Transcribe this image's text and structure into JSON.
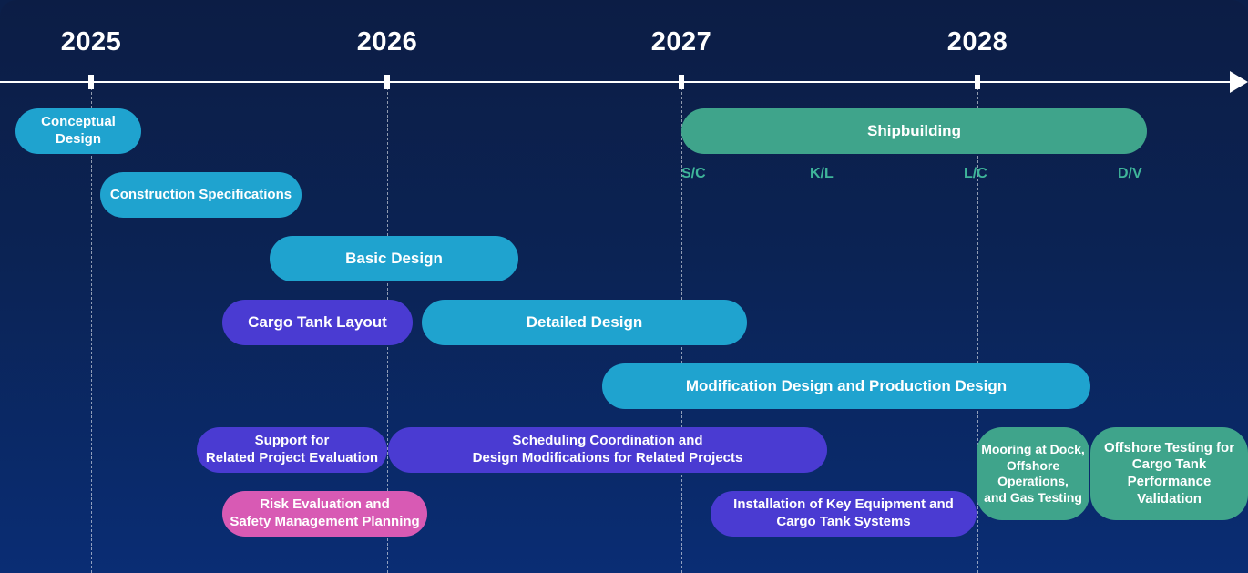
{
  "timeline": {
    "years": [
      "2025",
      "2026",
      "2027",
      "2028"
    ],
    "milestones": [
      "S/C",
      "K/L",
      "L/C",
      "D/V"
    ]
  },
  "tasks": {
    "conceptual_design": "Conceptual\nDesign",
    "construction_specifications": "Construction Specifications",
    "basic_design": "Basic Design",
    "cargo_tank_layout": "Cargo Tank Layout",
    "detailed_design": "Detailed Design",
    "modification_production_design": "Modification Design and Production Design",
    "support_evaluation": "Support for\nRelated Project Evaluation",
    "scheduling_coordination": "Scheduling Coordination and\nDesign Modifications for Related Projects",
    "risk_evaluation": "Risk Evaluation and\nSafety Management Planning",
    "installation_equipment": "Installation of Key Equipment and\nCargo Tank Systems",
    "shipbuilding": "Shipbuilding",
    "mooring_testing": "Mooring at Dock,\nOffshore\nOperations,\nand Gas Testing",
    "offshore_testing": "Offshore Testing for\nCargo Tank\nPerformance\nValidation"
  },
  "colors": {
    "design_blue": "#1fa3cf",
    "support_purple": "#4a3bd2",
    "risk_pink": "#d85ab4",
    "shipbuilding_green": "#3fa48b",
    "milestone_green": "#3fb59a"
  }
}
